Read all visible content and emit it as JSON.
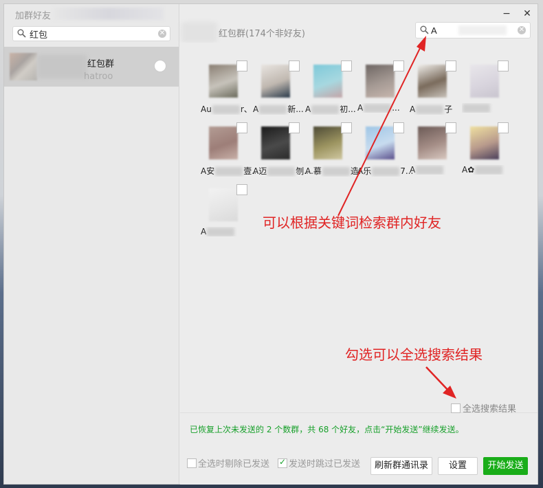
{
  "left_panel": {
    "title": "加群好友",
    "search_value": "红包",
    "group": {
      "name": "红包群",
      "subtitle": "hatroo"
    }
  },
  "right_panel": {
    "title": "红包群(174个非好友)",
    "search_value": "A",
    "window_buttons": {
      "minimize": "−",
      "close": "✕"
    },
    "members": [
      {
        "name_prefix": "Au",
        "name_suffix": "r、",
        "avatar": [
          "#8a7f73",
          "#c7c3bb",
          "#6b6b5c"
        ]
      },
      {
        "name_prefix": "A",
        "name_suffix": "新...",
        "avatar": [
          "#e8e4e0",
          "#c0b8b0",
          "#2a3a4a"
        ]
      },
      {
        "name_prefix": "A",
        "name_suffix": "初...",
        "avatar": [
          "#7ec9d9",
          "#a7d8e0",
          "#c4a5a8"
        ]
      },
      {
        "name_prefix": "A",
        "name_suffix": "...",
        "avatar": [
          "#6e6663",
          "#a59a94",
          "#c7b6ae"
        ]
      },
      {
        "name_prefix": "A",
        "name_suffix": "子",
        "avatar": [
          "#f0eeea",
          "#7a6b5c",
          "#c8c2ba"
        ]
      },
      {
        "name_prefix": "",
        "name_suffix": "",
        "avatar": [
          "#e8e6ea",
          "#d9d5de",
          "#c9c5cf"
        ]
      },
      {
        "name_prefix": "A安",
        "name_suffix": "壹...",
        "avatar": [
          "#b39c94",
          "#9d7e78",
          "#c8b0a8"
        ]
      },
      {
        "name_prefix": "A迈",
        "name_suffix": "刎...",
        "avatar": [
          "#1b1b1b",
          "#4a4a4a",
          "#2b2b2b"
        ]
      },
      {
        "name_prefix": "A.慕",
        "name_suffix": "造...",
        "avatar": [
          "#4d4a36",
          "#9c9460",
          "#cfc7a0"
        ]
      },
      {
        "name_prefix": "A乐",
        "name_suffix": "7...",
        "avatar": [
          "#9fc6e6",
          "#c8dcef",
          "#5a4f8c"
        ]
      },
      {
        "name_prefix": "A",
        "name_suffix": "",
        "avatar": [
          "#6b5a56",
          "#a48d86",
          "#d8c8c0"
        ]
      },
      {
        "name_prefix": "A✿",
        "name_suffix": "",
        "avatar": [
          "#efe0a0",
          "#b89a8c",
          "#4a3f5a"
        ]
      },
      {
        "name_prefix": "A",
        "name_suffix": "",
        "avatar": [
          "#f2f2f2",
          "#e6e6e6",
          "#dadada"
        ]
      }
    ]
  },
  "annotations": {
    "search_hint": "可以根据关键词检索群内好友",
    "select_hint": "勾选可以全选搜索结果"
  },
  "select_all_label": "全选搜索结果",
  "status_message": "已恢复上次未发送的 2 个数群，共 68 个好友，点击“开始发送”继续发送。",
  "options": {
    "remove_sent": "全选时剔除已发送",
    "skip_sent": "发送时跳过已发送"
  },
  "buttons": {
    "refresh": "刷新群通讯录",
    "settings": "设置",
    "start": "开始发送"
  },
  "colors": {
    "accent": "#1aad19",
    "annotation": "#e02424",
    "status": "#17a02a"
  }
}
